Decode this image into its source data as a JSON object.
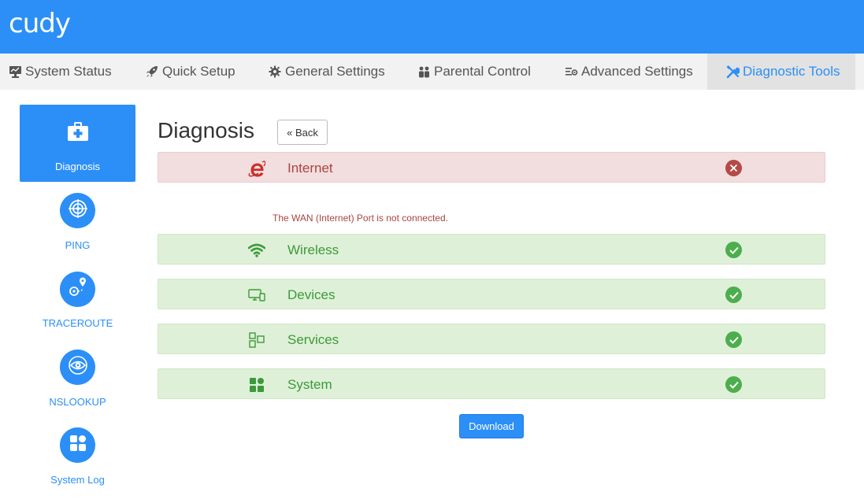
{
  "brand": {
    "logo": "cudy",
    "accent": "#2b8ff7"
  },
  "nav": {
    "items": [
      {
        "label": "System Status",
        "icon": "monitor-icon"
      },
      {
        "label": "Quick Setup",
        "icon": "rocket-icon"
      },
      {
        "label": "General Settings",
        "icon": "gear-icon"
      },
      {
        "label": "Parental Control",
        "icon": "family-icon"
      },
      {
        "label": "Advanced Settings",
        "icon": "sliders-icon"
      },
      {
        "label": "Diagnostic Tools",
        "icon": "tools-icon",
        "active": true
      }
    ]
  },
  "sidebar": {
    "items": [
      {
        "label": "Diagnosis",
        "icon": "medkit-icon",
        "active": true
      },
      {
        "label": "PING",
        "icon": "target-icon"
      },
      {
        "label": "TRACEROUTE",
        "icon": "route-icon"
      },
      {
        "label": "NSLOOKUP",
        "icon": "eye-icon"
      },
      {
        "label": "System Log",
        "icon": "grid-icon"
      }
    ]
  },
  "main": {
    "title": "Diagnosis",
    "back_label": "« Back",
    "rows": [
      {
        "label": "Internet",
        "icon": "ie-icon",
        "status": "error"
      },
      {
        "label": "Wireless",
        "icon": "wifi-icon",
        "status": "ok"
      },
      {
        "label": "Devices",
        "icon": "devices-icon",
        "status": "ok"
      },
      {
        "label": "Services",
        "icon": "services-icon",
        "status": "ok"
      },
      {
        "label": "System",
        "icon": "system-icon",
        "status": "ok"
      }
    ],
    "error_message": "The WAN (Internet) Port is not connected.",
    "download_label": "Download"
  },
  "colors": {
    "error_bg": "#f2dede",
    "error_text": "#a94442",
    "ok_bg": "#dff0d8",
    "ok_text": "#3c9a3c"
  }
}
